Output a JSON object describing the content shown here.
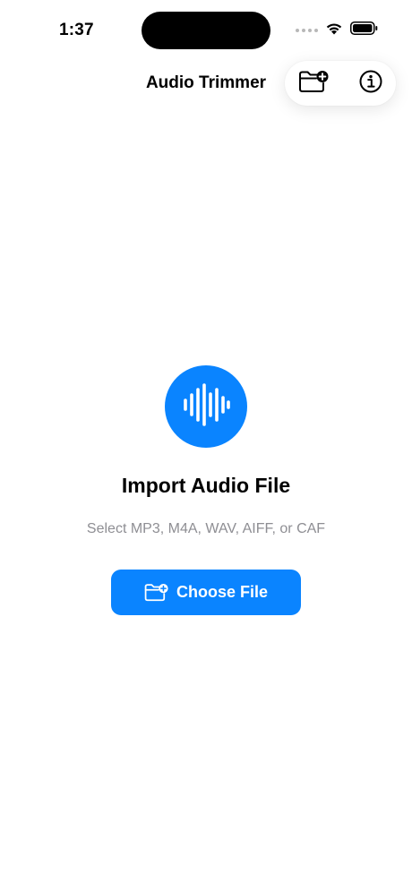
{
  "status_bar": {
    "time": "1:37"
  },
  "nav": {
    "title": "Audio Trimmer",
    "actions": [
      {
        "icon": "folder-add-icon"
      },
      {
        "icon": "info-icon"
      }
    ]
  },
  "empty_state": {
    "icon": "waveform-icon",
    "title": "Import Audio File",
    "subtitle": "Select MP3, M4A, WAV, AIFF, or CAF",
    "button": {
      "label": "Choose File",
      "icon": "folder-add-icon"
    }
  },
  "colors": {
    "accent": "#0a84ff",
    "secondary_text": "#8e8e93",
    "background": "#ffffff"
  }
}
